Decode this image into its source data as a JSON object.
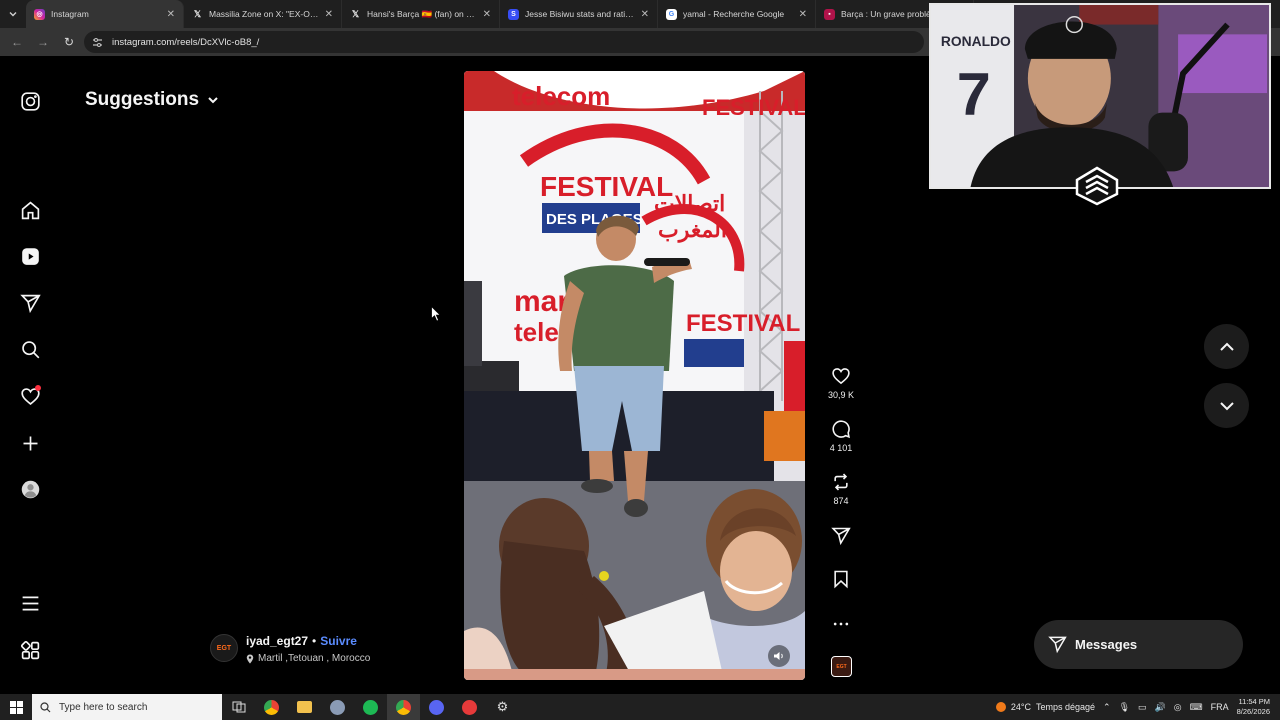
{
  "browser": {
    "tabs": [
      {
        "title": "Instagram",
        "favicon": "instagram-icon",
        "color": "#d6249f",
        "active": true
      },
      {
        "title": "Massilia Zone on X: \"EX-OM :",
        "favicon": "x-icon",
        "color": "#000000",
        "active": false
      },
      {
        "title": "Hansi's Barça 🇪🇸 (fan) on X: \"Xa",
        "favicon": "x-icon",
        "color": "#000000",
        "active": false
      },
      {
        "title": "Jesse Bisiwu stats and ratings |",
        "favicon": "sofascore-icon",
        "color": "#374df5",
        "active": false
      },
      {
        "title": "yamal - Recherche Google",
        "favicon": "google-icon",
        "color": "#ffffff",
        "active": false
      },
      {
        "title": "Barça : Un grave problè",
        "favicon": "news-icon",
        "color": "#b1134a",
        "active": false
      }
    ],
    "url": "instagram.com/reels/DcXVlc-oB8_/"
  },
  "instagram": {
    "sidebar_icons": [
      "instagram-logo-icon",
      "home-icon",
      "reels-icon",
      "send-icon",
      "search-icon",
      "heart-icon",
      "create-icon",
      "profile-icon",
      "menu-icon",
      "apps-icon"
    ],
    "suggestions_label": "Suggestions",
    "reel": {
      "author": "iyad_egt27",
      "separator": "•",
      "follow_label": "Suivre",
      "location": "Martil ,Tetouan , Morocco",
      "avatar_text": "EGT",
      "video_text": {
        "brand_top": "telecom",
        "festival": "FESTIVAL",
        "des_plages": "DES PLAGES",
        "arabic_1": "اتصالات",
        "arabic_2": "المغرب",
        "brand_mid_1": "mar",
        "brand_mid_2": "telecom"
      }
    },
    "actions": {
      "likes": "30,9 K",
      "comments": "4 101",
      "reposts": "874"
    },
    "messages_label": "Messages"
  },
  "webcam": {
    "jersey_name": "RONALDO",
    "jersey_number": "7"
  },
  "taskbar": {
    "search_placeholder": "Type here to search",
    "weather_temp": "24°C",
    "weather_text": "Temps dégagé",
    "language": "FRA",
    "time": "11:54 PM",
    "date": "8/26/2026"
  }
}
